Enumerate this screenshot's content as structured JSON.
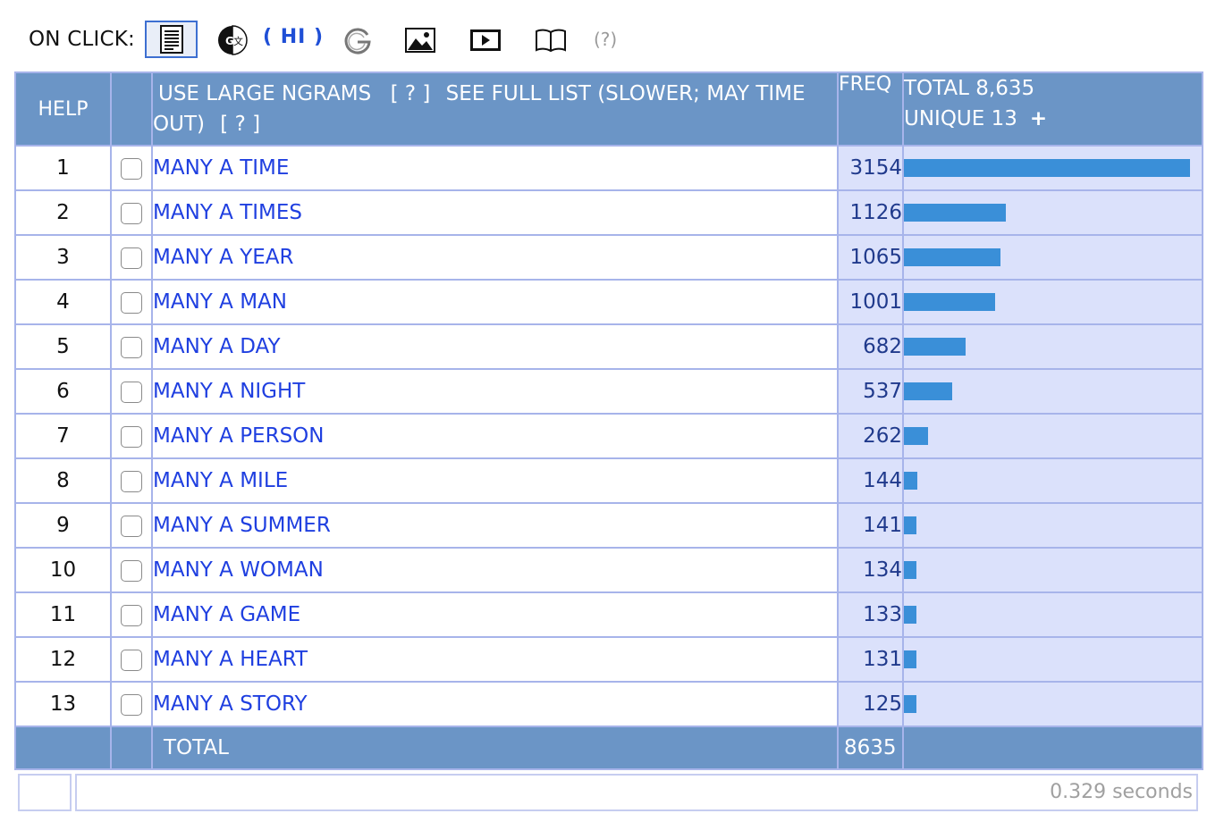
{
  "toolbar": {
    "on_click_label": "ON CLICK:",
    "icons": [
      "document-icon",
      "google-translate-icon",
      "hi-language",
      "google-icon",
      "image-icon",
      "video-icon",
      "book-icon",
      "help-icon"
    ],
    "hi_label": "( HI )",
    "help_label": "(?)",
    "selected_icon": "document-icon"
  },
  "table": {
    "header": {
      "help": "HELP",
      "use_large_ngrams": "USE LARGE NGRAMS",
      "q1": "[ ? ]",
      "see_full_list": "SEE FULL LIST (SLOWER; MAY TIME",
      "out": "OUT)",
      "q2": "[ ? ]",
      "freq": "FREQ",
      "total_line": "TOTAL 8,635",
      "unique_line": "UNIQUE 13",
      "plus": "+"
    },
    "rows": [
      {
        "num": "1",
        "phrase": "MANY A TIME",
        "freq": "3154",
        "freq_value": 3154
      },
      {
        "num": "2",
        "phrase": "MANY A TIMES",
        "freq": "1126",
        "freq_value": 1126
      },
      {
        "num": "3",
        "phrase": "MANY A YEAR",
        "freq": "1065",
        "freq_value": 1065
      },
      {
        "num": "4",
        "phrase": "MANY A MAN",
        "freq": "1001",
        "freq_value": 1001
      },
      {
        "num": "5",
        "phrase": "MANY A DAY",
        "freq": "682",
        "freq_value": 682
      },
      {
        "num": "6",
        "phrase": "MANY A NIGHT",
        "freq": "537",
        "freq_value": 537
      },
      {
        "num": "7",
        "phrase": "MANY A PERSON",
        "freq": "262",
        "freq_value": 262
      },
      {
        "num": "8",
        "phrase": "MANY A MILE",
        "freq": "144",
        "freq_value": 144
      },
      {
        "num": "9",
        "phrase": "MANY A SUMMER",
        "freq": "141",
        "freq_value": 141
      },
      {
        "num": "10",
        "phrase": "MANY A WOMAN",
        "freq": "134",
        "freq_value": 134
      },
      {
        "num": "11",
        "phrase": "MANY A GAME",
        "freq": "133",
        "freq_value": 133
      },
      {
        "num": "12",
        "phrase": "MANY A HEART",
        "freq": "131",
        "freq_value": 131
      },
      {
        "num": "13",
        "phrase": "MANY A STORY",
        "freq": "125",
        "freq_value": 125
      }
    ],
    "footer": {
      "label": "TOTAL",
      "freq": "8635"
    }
  },
  "timing": "0.329 seconds",
  "colors": {
    "header_bg": "#6b95c6",
    "freq_bg": "#dbe1fb",
    "bar": "#3a8fd8",
    "link": "#1f3fe0",
    "border": "#a7b4ea"
  }
}
